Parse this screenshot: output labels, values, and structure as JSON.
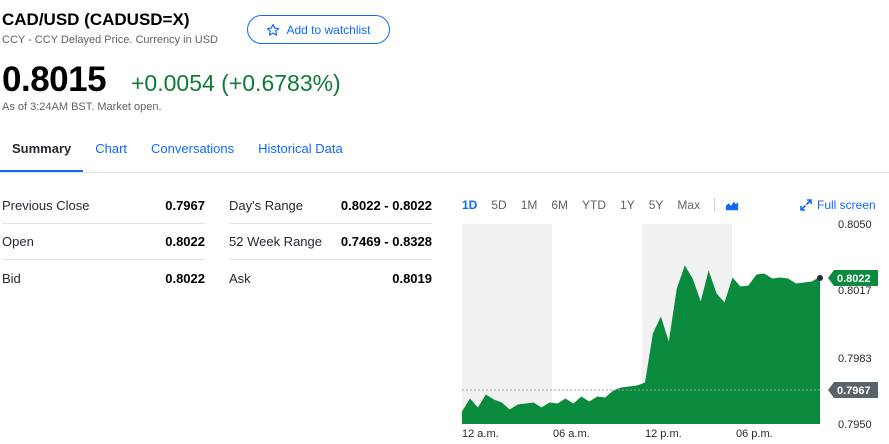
{
  "header": {
    "title": "CAD/USD (CADUSD=X)",
    "subtitle": "CCY - CCY Delayed Price. Currency in USD",
    "watchlist_label": "Add to watchlist"
  },
  "quote": {
    "price": "0.8015",
    "change": "+0.0054 (+0.6783%)",
    "as_of": "As of 3:24AM BST. Market open.",
    "change_color": "#0f7b37"
  },
  "tabs": [
    {
      "label": "Summary",
      "active": true
    },
    {
      "label": "Chart"
    },
    {
      "label": "Conversations"
    },
    {
      "label": "Historical Data"
    }
  ],
  "stats": {
    "left": [
      {
        "label": "Previous Close",
        "value": "0.7967"
      },
      {
        "label": "Open",
        "value": "0.8022"
      },
      {
        "label": "Bid",
        "value": "0.8022"
      }
    ],
    "right": [
      {
        "label": "Day's Range",
        "value": "0.8022 - 0.8022"
      },
      {
        "label": "52 Week Range",
        "value": "0.7469 - 0.8328"
      },
      {
        "label": "Ask",
        "value": "0.8019"
      }
    ]
  },
  "chart_controls": {
    "ranges": [
      "1D",
      "5D",
      "1M",
      "6M",
      "YTD",
      "1Y",
      "5Y",
      "Max"
    ],
    "active_range": "1D",
    "chart_type_icon": "area-chart-icon",
    "fullscreen_label": "Full screen",
    "fullscreen_icon": "expand-icon"
  },
  "chart_data": {
    "type": "area",
    "x_tick_labels": [
      "12 a.m.",
      "06 a.m.",
      "12 p.m.",
      "06 p.m."
    ],
    "y_tick_labels": [
      "0.8050",
      "0.8017",
      "0.7983",
      "0.7950"
    ],
    "ylim": [
      0.795,
      0.805
    ],
    "current_price_label": "0.8022",
    "previous_close_label": "0.7967",
    "previous_close": 0.7967,
    "series": [
      {
        "values": [
          0.7957,
          0.7962,
          0.7959,
          0.7964,
          0.7963,
          0.796,
          0.7958,
          0.7959,
          0.7961,
          0.796,
          0.7959,
          0.796,
          0.7961,
          0.7962,
          0.7961,
          0.7963,
          0.7962,
          0.7963,
          0.7964,
          0.7966,
          0.7969,
          0.7968,
          0.797,
          0.797,
          0.7996,
          0.8003,
          0.7992,
          0.8017,
          0.803,
          0.8022,
          0.8012,
          0.8026,
          0.8016,
          0.801,
          0.8024,
          0.8018,
          0.802,
          0.8024,
          0.8026,
          0.8022,
          0.8024,
          0.8022,
          0.8021,
          0.802,
          0.8022,
          0.8023
        ]
      }
    ],
    "colors": {
      "area": "#0a8a3c",
      "up_badge": "#0a8a3c",
      "close_badge": "#5b636a",
      "shade": "#f1f1f1"
    }
  }
}
